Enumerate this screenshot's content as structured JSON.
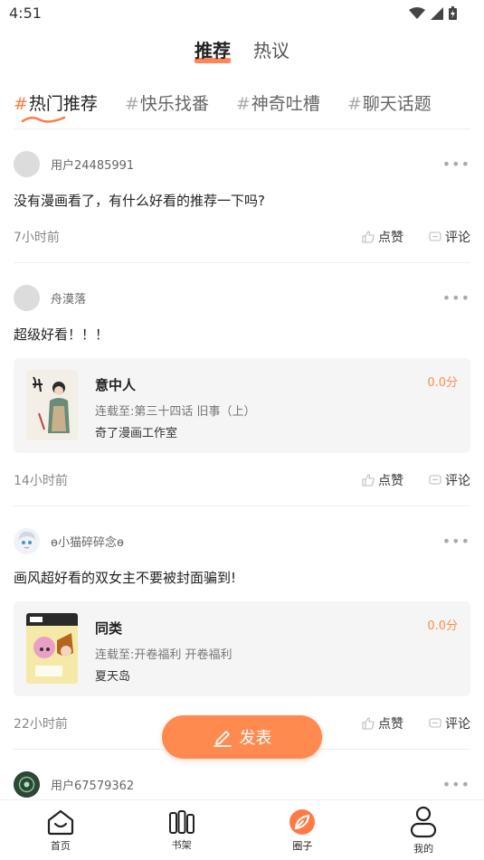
{
  "status": {
    "time": "4:51"
  },
  "top_tabs": [
    {
      "label": "推荐",
      "active": true
    },
    {
      "label": "热议",
      "active": false
    }
  ],
  "topics": [
    {
      "hash": "#",
      "label": "热门推荐",
      "active": true
    },
    {
      "hash": "#",
      "label": "快乐找番",
      "active": false
    },
    {
      "hash": "#",
      "label": "神奇吐槽",
      "active": false
    },
    {
      "hash": "#",
      "label": "聊天话题",
      "active": false
    }
  ],
  "posts": [
    {
      "username": "用户24485991",
      "text": "没有漫画看了，有什么好看的推荐一下吗?",
      "time": "7小时前",
      "like_label": "点赞",
      "comment_label": "评论"
    },
    {
      "username": "舟漠落",
      "text": "超级好看！！！",
      "time": "14小时前",
      "like_label": "点赞",
      "comment_label": "评论",
      "comic": {
        "title": "意中人",
        "chapter": "连载至:第三十四话 旧事（上）",
        "author": "奇了漫画工作室",
        "score": "0.0分"
      }
    },
    {
      "username": "ɵ小猫碎碎念ɵ",
      "text": "画风超好看的双女主不要被封面骗到!",
      "time": "22小时前",
      "like_label": "点赞",
      "comment_label": "评论",
      "comic": {
        "title": "同类",
        "chapter": "连载至:开卷福利 开卷福利",
        "author": "夏天岛",
        "score": "0.0分"
      }
    },
    {
      "username": "用户67579362"
    }
  ],
  "publish_label": "发表",
  "nav": [
    {
      "label": "首页",
      "icon": "home-icon"
    },
    {
      "label": "书架",
      "icon": "bookshelf-icon"
    },
    {
      "label": "圈子",
      "icon": "circle-icon",
      "active": true
    },
    {
      "label": "我的",
      "icon": "profile-icon"
    }
  ],
  "colors": {
    "accent": "#ff8a50",
    "text": "#222222",
    "muted": "#888888"
  }
}
